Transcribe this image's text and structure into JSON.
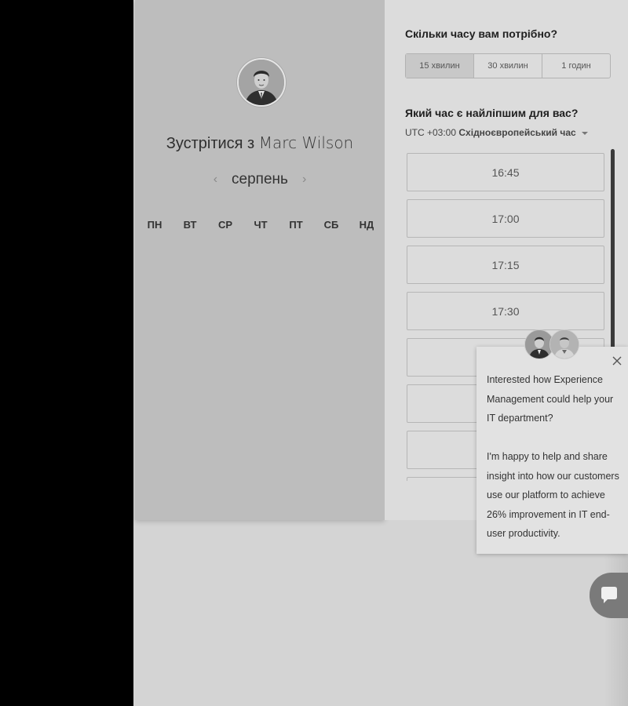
{
  "scheduler": {
    "title_prefix": "Зустрітися з",
    "host_name": "Marc Wilson",
    "month": "серпень",
    "prev_month_icon": "‹",
    "next_month_icon": "›",
    "weekdays": [
      "ПН",
      "ВТ",
      "СР",
      "ЧТ",
      "ПТ",
      "СБ",
      "НД"
    ]
  },
  "duration": {
    "question": "Скільки часу вам потрібно?",
    "options": [
      "15 хвилин",
      "30 хвилин",
      "1 годин"
    ],
    "selected": "15 хвилин"
  },
  "time": {
    "question": "Який час є найліпшим для вас?",
    "tz_offset": "UTC +03:00",
    "tz_name": "Східноєвропейський час",
    "slots": [
      "16:45",
      "17:00",
      "17:15",
      "17:30",
      "",
      "",
      "",
      ""
    ]
  },
  "chat": {
    "paragraph1": "Interested how Experience Management could help your IT department?",
    "paragraph2": "I'm happy to help and share insight into how our customers use our platform to achieve 26% improvement in IT end-user productivity.",
    "icons": [
      "close-icon",
      "chat-bubble-icon"
    ]
  }
}
